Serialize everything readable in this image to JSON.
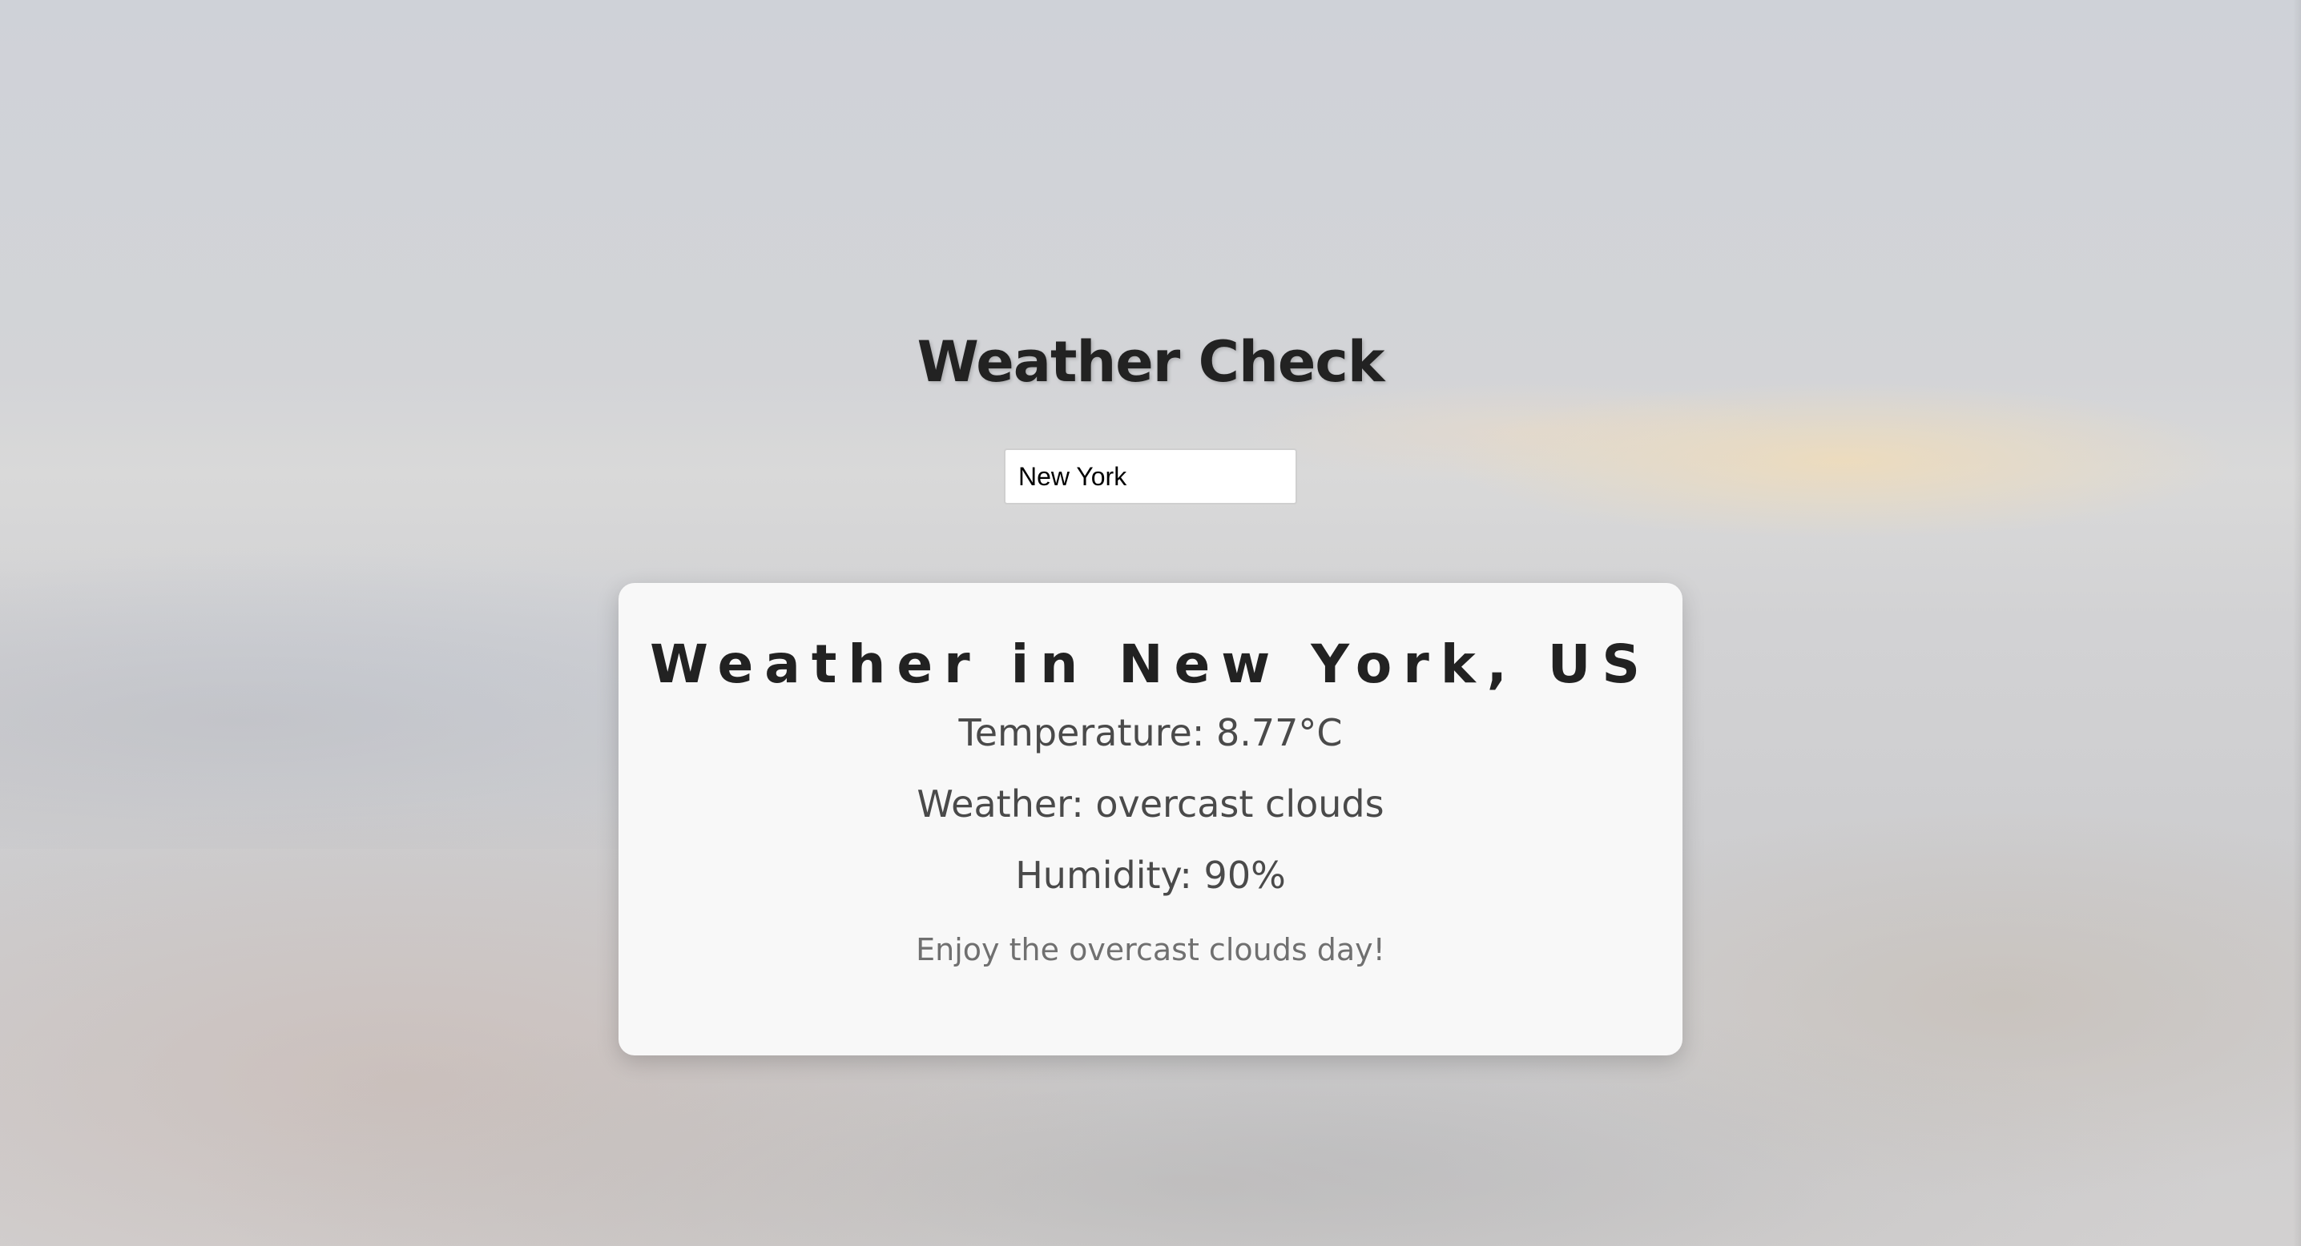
{
  "app": {
    "title": "Weather Check"
  },
  "search": {
    "value": "New York"
  },
  "weather": {
    "heading": "Weather in New York, US",
    "temperature": "Temperature: 8.77°C",
    "condition": "Weather: overcast clouds",
    "humidity": "Humidity: 90%",
    "message": "Enjoy the overcast clouds day!"
  },
  "colors": {
    "card_background": "#f8f8f8",
    "heading_text": "#222222",
    "body_text": "#4a4a4a",
    "message_text": "#707070"
  }
}
